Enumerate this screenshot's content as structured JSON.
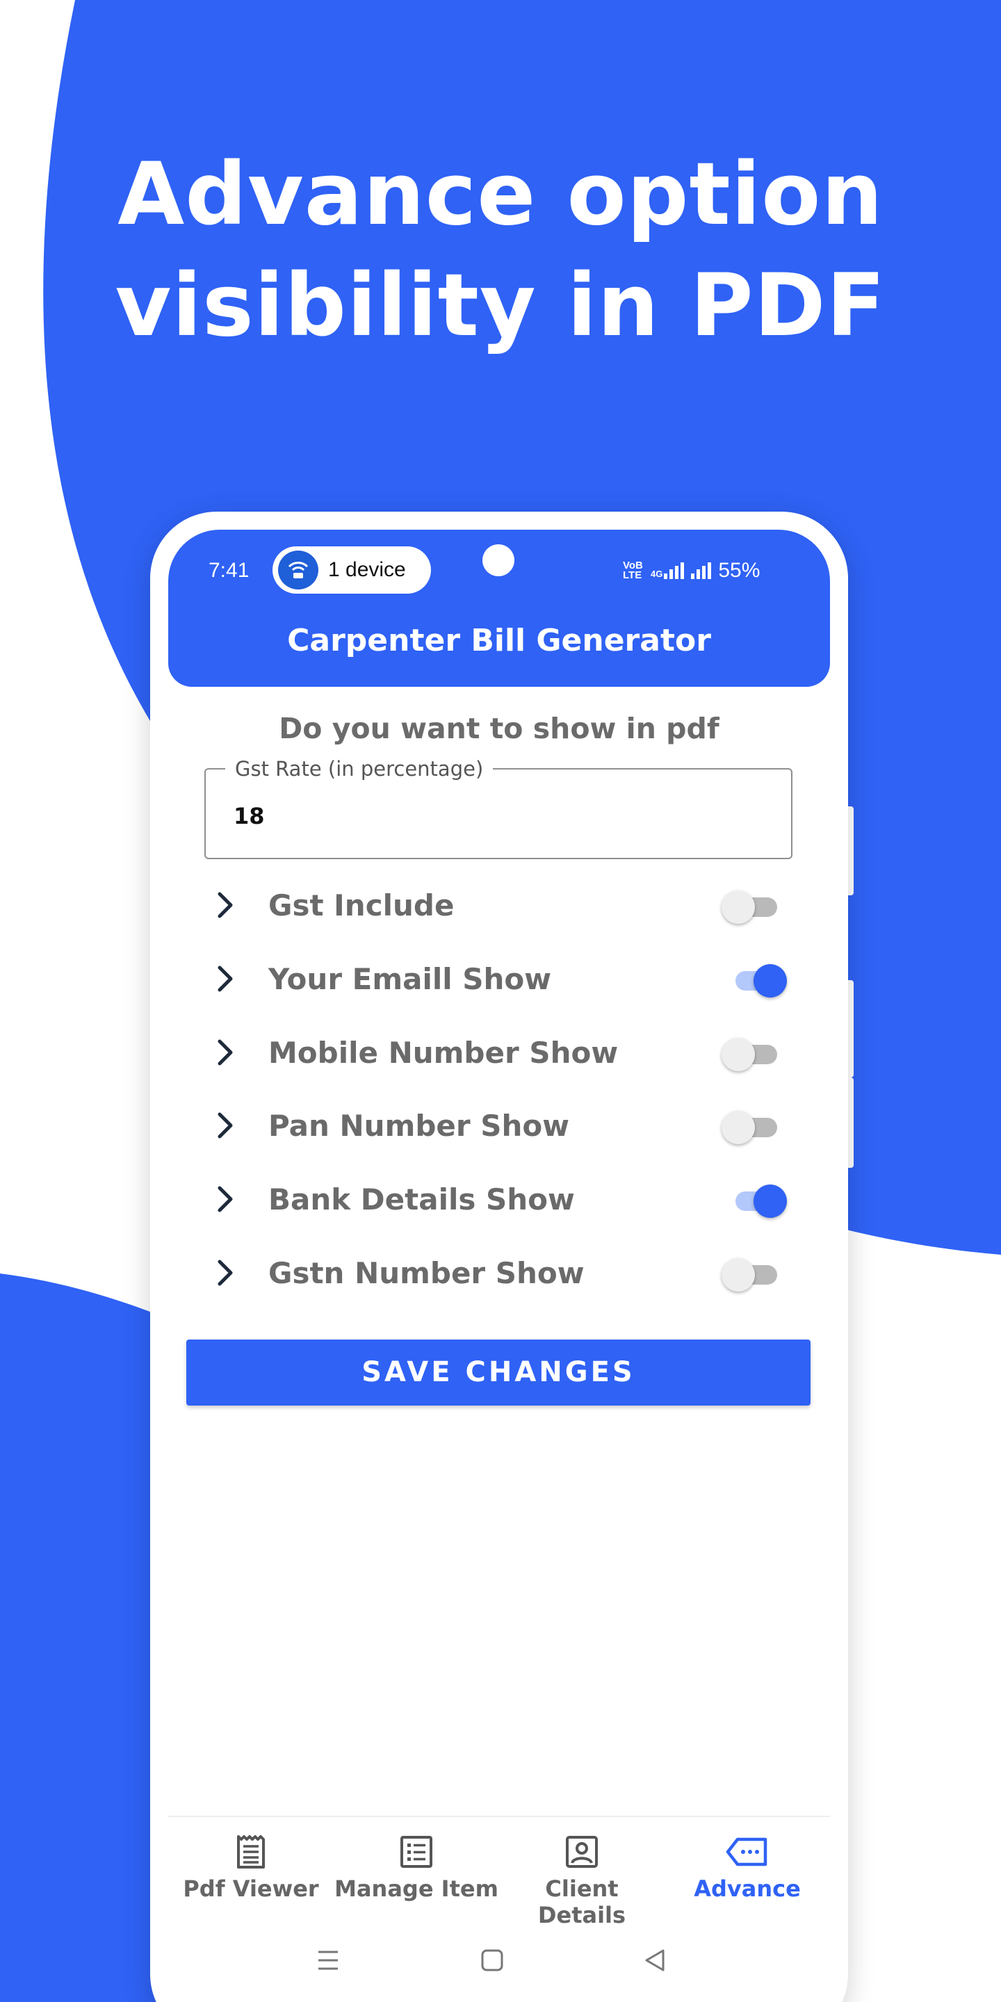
{
  "headline": {
    "line1": "Advance option",
    "line2": "visibility in PDF"
  },
  "status_bar": {
    "time": "7:41",
    "hotspot_label": "1 device",
    "net1": "VoB LTE",
    "net2": "4G",
    "battery": "55%"
  },
  "app": {
    "title": "Carpenter Bill Generator",
    "subheading": "Do you want to show in pdf"
  },
  "gst_field": {
    "label": "Gst Rate (in percentage)",
    "value": "18"
  },
  "options": [
    {
      "label": "Gst Include",
      "enabled": false
    },
    {
      "label": "Your Emaill Show",
      "enabled": true
    },
    {
      "label": "Mobile Number Show",
      "enabled": false
    },
    {
      "label": "Pan Number Show",
      "enabled": false
    },
    {
      "label": "Bank Details Show",
      "enabled": true
    },
    {
      "label": "Gstn Number Show",
      "enabled": false
    }
  ],
  "save_button": "SAVE CHANGES",
  "bottom_nav": [
    {
      "label": "Pdf Viewer",
      "icon": "receipt-icon",
      "active": false
    },
    {
      "label": "Manage Item",
      "icon": "list-icon",
      "active": false
    },
    {
      "label": "Client Details",
      "icon": "contact-icon",
      "active": false
    },
    {
      "label": "Advance",
      "icon": "tag-icon",
      "active": true
    }
  ],
  "colors": {
    "accent": "#2f62f5",
    "label_gray": "#6a6a6a"
  }
}
